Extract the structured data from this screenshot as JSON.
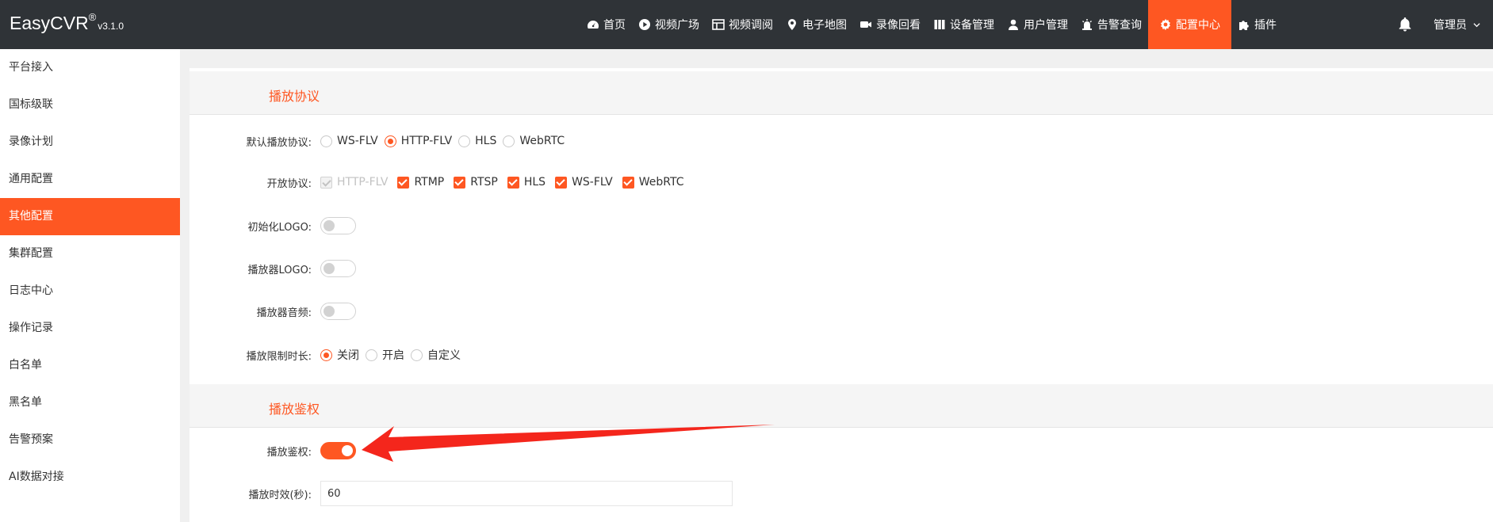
{
  "app": {
    "brand": "EasyCVR",
    "trademark": "®",
    "version": "v3.1.0"
  },
  "nav": [
    {
      "label": "首页",
      "icon": "dashboard-icon"
    },
    {
      "label": "视频广场",
      "icon": "play-circle-icon"
    },
    {
      "label": "视频调阅",
      "icon": "grid-layout-icon"
    },
    {
      "label": "电子地图",
      "icon": "map-pin-icon"
    },
    {
      "label": "录像回看",
      "icon": "video-camera-icon"
    },
    {
      "label": "设备管理",
      "icon": "devices-icon"
    },
    {
      "label": "用户管理",
      "icon": "user-icon"
    },
    {
      "label": "告警查询",
      "icon": "alarm-icon"
    },
    {
      "label": "配置中心",
      "icon": "gear-icon",
      "active": true
    },
    {
      "label": "插件",
      "icon": "puzzle-icon"
    }
  ],
  "user": {
    "name": "管理员"
  },
  "sidebar": {
    "items": [
      {
        "label": "平台接入"
      },
      {
        "label": "国标级联"
      },
      {
        "label": "录像计划"
      },
      {
        "label": "通用配置"
      },
      {
        "label": "其他配置",
        "active": true
      },
      {
        "label": "集群配置"
      },
      {
        "label": "日志中心"
      },
      {
        "label": "操作记录"
      },
      {
        "label": "白名单"
      },
      {
        "label": "黑名单"
      },
      {
        "label": "告警预案"
      },
      {
        "label": "AI数据对接"
      }
    ]
  },
  "playback": {
    "section_title": "播放协议",
    "default_protocol": {
      "label": "默认播放协议:",
      "options": [
        "WS-FLV",
        "HTTP-FLV",
        "HLS",
        "WebRTC"
      ],
      "selected": "HTTP-FLV"
    },
    "open_protocols": {
      "label": "开放协议:",
      "options": [
        "HTTP-FLV",
        "RTMP",
        "RTSP",
        "HLS",
        "WS-FLV",
        "WebRTC"
      ],
      "disabled": "HTTP-FLV"
    },
    "init_logo": {
      "label": "初始化LOGO:",
      "on": false
    },
    "player_logo": {
      "label": "播放器LOGO:",
      "on": false
    },
    "player_audio": {
      "label": "播放器音频:",
      "on": false
    },
    "time_limit": {
      "label": "播放限制时长:",
      "options": [
        "关闭",
        "开启",
        "自定义"
      ],
      "selected": "关闭"
    }
  },
  "auth": {
    "section_title": "播放鉴权",
    "auth_switch": {
      "label": "播放鉴权:",
      "on": true
    },
    "validity": {
      "label": "播放时效(秒):",
      "value": "60"
    }
  },
  "colors": {
    "accent": "#fe5722",
    "header_bg": "#2f3337",
    "annotation_arrow": "#f4261c"
  }
}
